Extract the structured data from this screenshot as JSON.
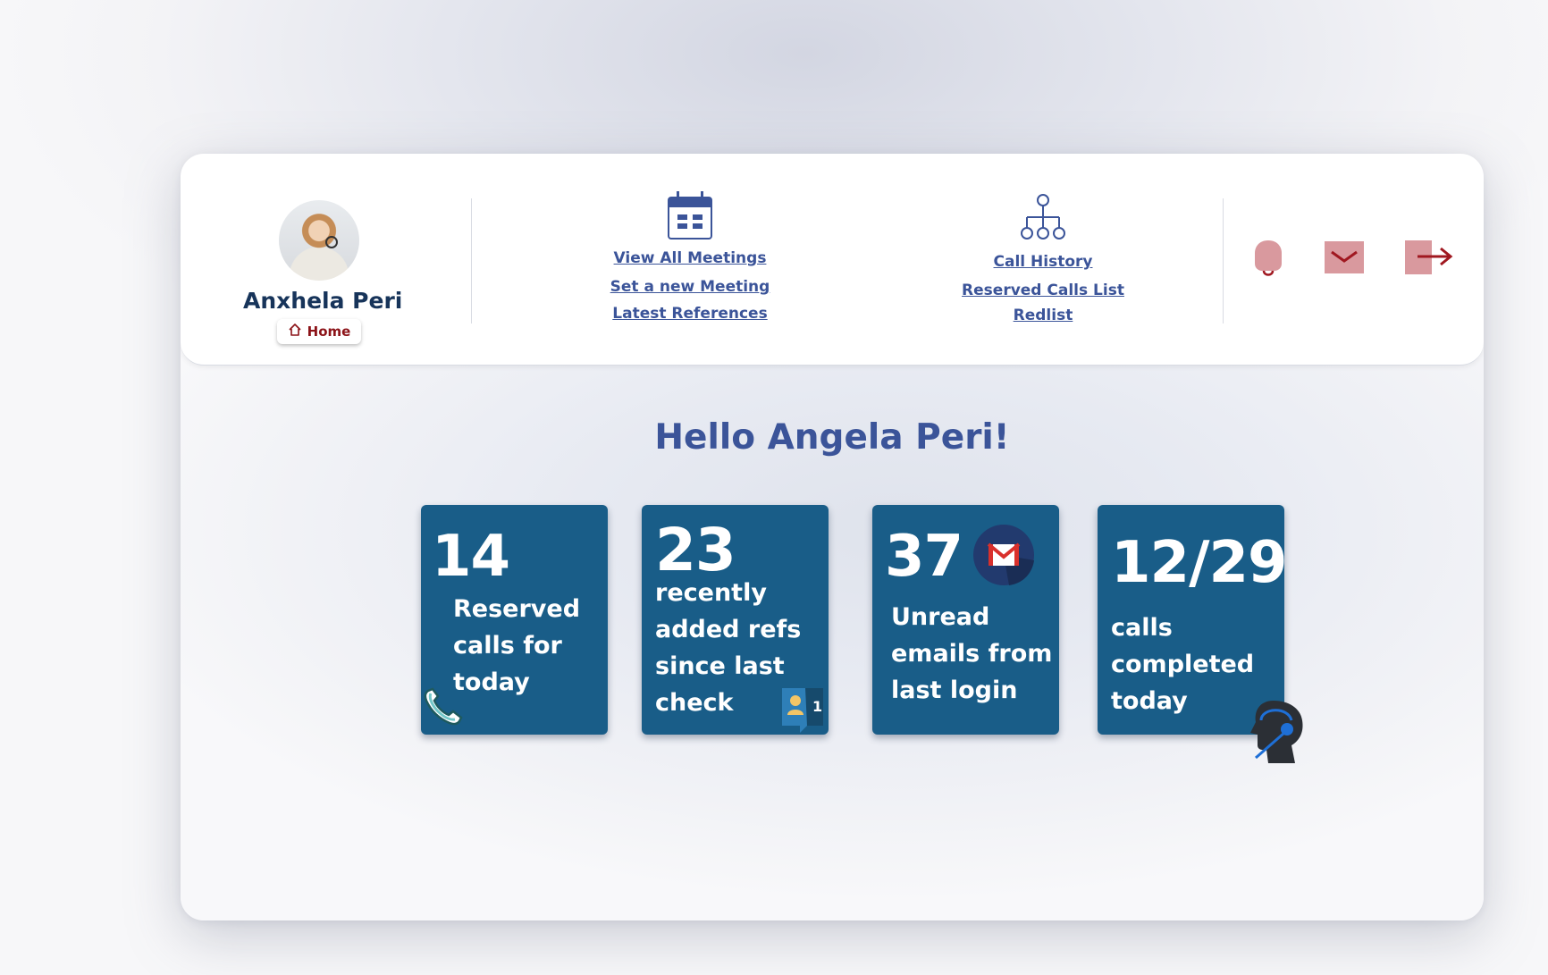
{
  "user": {
    "name": "Anxhela Peri",
    "home_label": "Home"
  },
  "nav": {
    "meetings": {
      "icon": "calendar-icon",
      "links": [
        "View All Meetings",
        "Set a new Meeting",
        "Latest References"
      ]
    },
    "calls": {
      "icon": "hierarchy-icon",
      "links": [
        "Call History",
        "Reserved Calls List",
        "Redlist"
      ]
    },
    "actions": [
      "bell-icon",
      "mail-icon",
      "logout-icon"
    ],
    "action_color": "#d9999e",
    "action_accent": "#a01820"
  },
  "greeting": "Hello Angela Peri!",
  "cards": [
    {
      "value": "14",
      "text": "Reserved calls for today",
      "icon": "phone-icon"
    },
    {
      "value": "23",
      "text": "recently added refs since last check",
      "icon": "user-notification-icon",
      "badge": "1"
    },
    {
      "value": "37",
      "text": "Unread emails from last login",
      "icon": "gmail-icon"
    },
    {
      "value": "12/29",
      "text": "calls completed today",
      "icon": "headset-agent-icon"
    }
  ],
  "colors": {
    "card_bg": "#195d88",
    "link": "#3b5499",
    "name": "#17345a",
    "home": "#8c1318"
  }
}
